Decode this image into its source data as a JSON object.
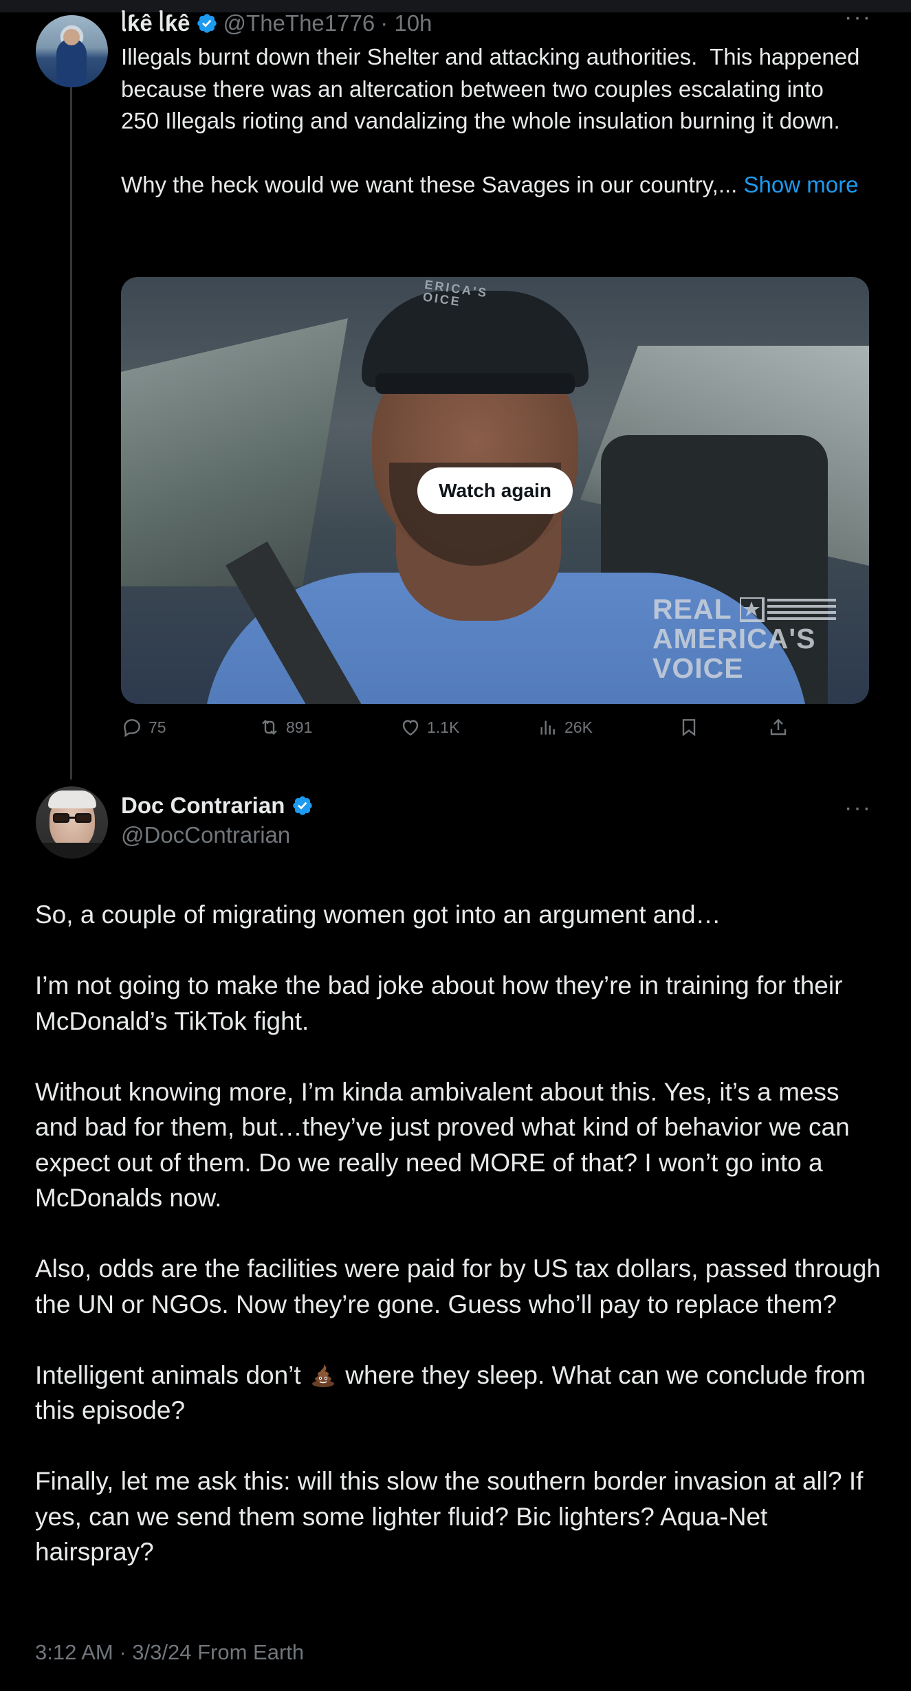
{
  "parent_tweet": {
    "display_name": "ᥣƙê ᥣƙê",
    "handle": "@TheThe1776",
    "time": "· 10h",
    "text": "Illegals burnt down their Shelter and attacking authorities.  This happened because there was an altercation between two couples escalating into 250 Illegals rioting and vandalizing the whole insulation burning it down.\n\nWhy the heck would we want these Savages in our country,... ",
    "show_more": "Show more",
    "media": {
      "overlay_button": "Watch again",
      "cap_text": "ERICA'S\nOICE",
      "watermark": "REAL\nAMERICA'S\nVOICE"
    },
    "actions": {
      "replies": "75",
      "reposts": "891",
      "likes": "1.1K",
      "views": "26K"
    }
  },
  "main_tweet": {
    "display_name": "Doc Contrarian",
    "handle": "@DocContrarian",
    "paragraphs": [
      "So, a couple of migrating women got into an argument and…",
      "I’m not going to make the bad joke about how they’re in training for their McDonald’s TikTok fight.",
      "Without knowing more, I’m kinda ambivalent about this. Yes, it’s a mess and bad for them, but…they’ve just proved what kind of behavior we can expect out of them. Do we really need MORE of that? I won’t go into a McDonalds now.",
      "Also, odds are the facilities were paid for by US tax dollars, passed through the UN or NGOs. Now they’re gone. Guess who’ll pay to replace them?"
    ],
    "emoji_paragraph": {
      "before": "Intelligent animals don’t",
      "emoji": "pile-of-poo-icon",
      "after": "where they sleep. What can we conclude from this episode?"
    },
    "final_paragraph": "Finally, let me ask this: will this slow the southern border invasion at all? If yes, can we send them some lighter fluid? Bic lighters? Aqua-Net hairspray?",
    "meta": "3:12 AM · 3/3/24 From Earth"
  },
  "colors": {
    "background": "#000000",
    "text": "#e7e9ea",
    "secondary": "#71767b",
    "link": "#1d9bf0",
    "verified": "#1d9bf0"
  }
}
